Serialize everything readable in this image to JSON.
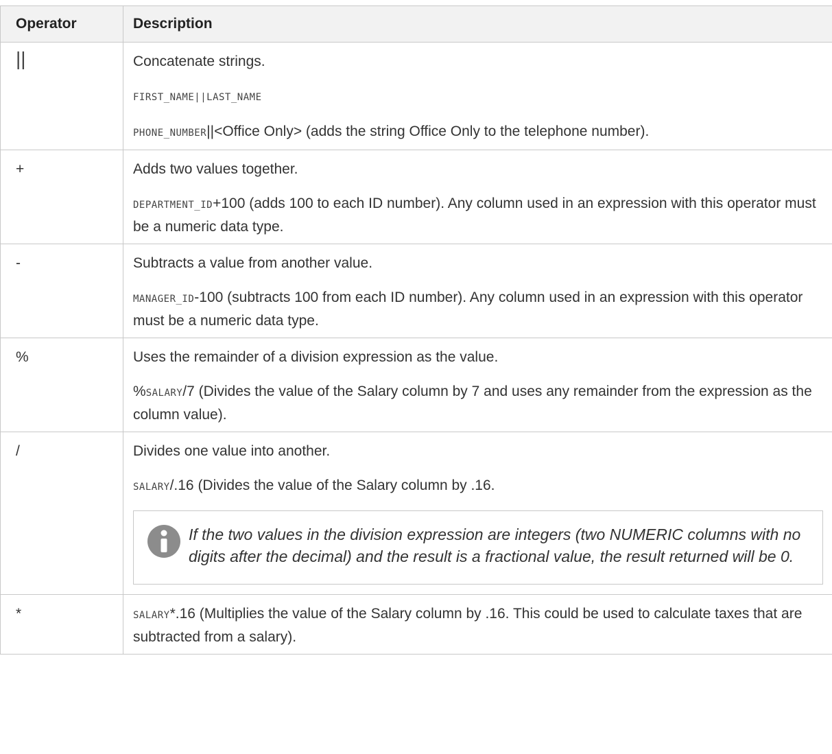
{
  "header": {
    "operator_label": "Operator",
    "description_label": "Description"
  },
  "rows": [
    {
      "operator": "||",
      "lines": [
        {
          "text": "Concatenate strings."
        },
        {
          "code": "FIRST_NAME||LAST_NAME",
          "text": ""
        },
        {
          "code": "PHONE_NUMBER",
          "text": "||<Office Only> (adds the string Office Only to the telephone number)."
        }
      ]
    },
    {
      "operator": "+",
      "lines": [
        {
          "text": "Adds two values together."
        },
        {
          "code": "DEPARTMENT_ID",
          "text": "+100 (adds 100 to each ID number). Any column used in an expression with this operator must be a numeric data type."
        }
      ]
    },
    {
      "operator": "-",
      "lines": [
        {
          "text": "Subtracts a value from another value."
        },
        {
          "code": "MANAGER_ID",
          "text": "-100 (subtracts 100 from each ID number). Any column used in an expression with this operator must be a numeric data type."
        }
      ]
    },
    {
      "operator": "%",
      "lines": [
        {
          "text": "Uses the remainder of a division expression as the value."
        },
        {
          "prefix": "%",
          "code": "SALARY",
          "text": "/7 (Divides the value of the Salary column by 7 and uses any remainder from the expression as the column value)."
        }
      ]
    },
    {
      "operator": "/",
      "lines": [
        {
          "text": "Divides one value into another."
        },
        {
          "code": "SALARY",
          "text": "/.16 (Divides the value of the Salary column by .16."
        }
      ],
      "note": "If the two values in the division expression are integers (two NUMERIC columns with no digits after the decimal) and the result is a fractional value, the result returned will be 0."
    },
    {
      "operator": "*",
      "lines": [
        {
          "code": "SALARY",
          "text": "*.16 (Multiplies the value of the Salary column by .16. This could be used to calculate taxes that are subtracted from a salary)."
        }
      ]
    }
  ],
  "icons": {
    "note_icon": "info-icon"
  },
  "colors": {
    "border": "#c8c8c8",
    "header_bg": "#f2f2f2",
    "icon": "#8c8c8c"
  }
}
